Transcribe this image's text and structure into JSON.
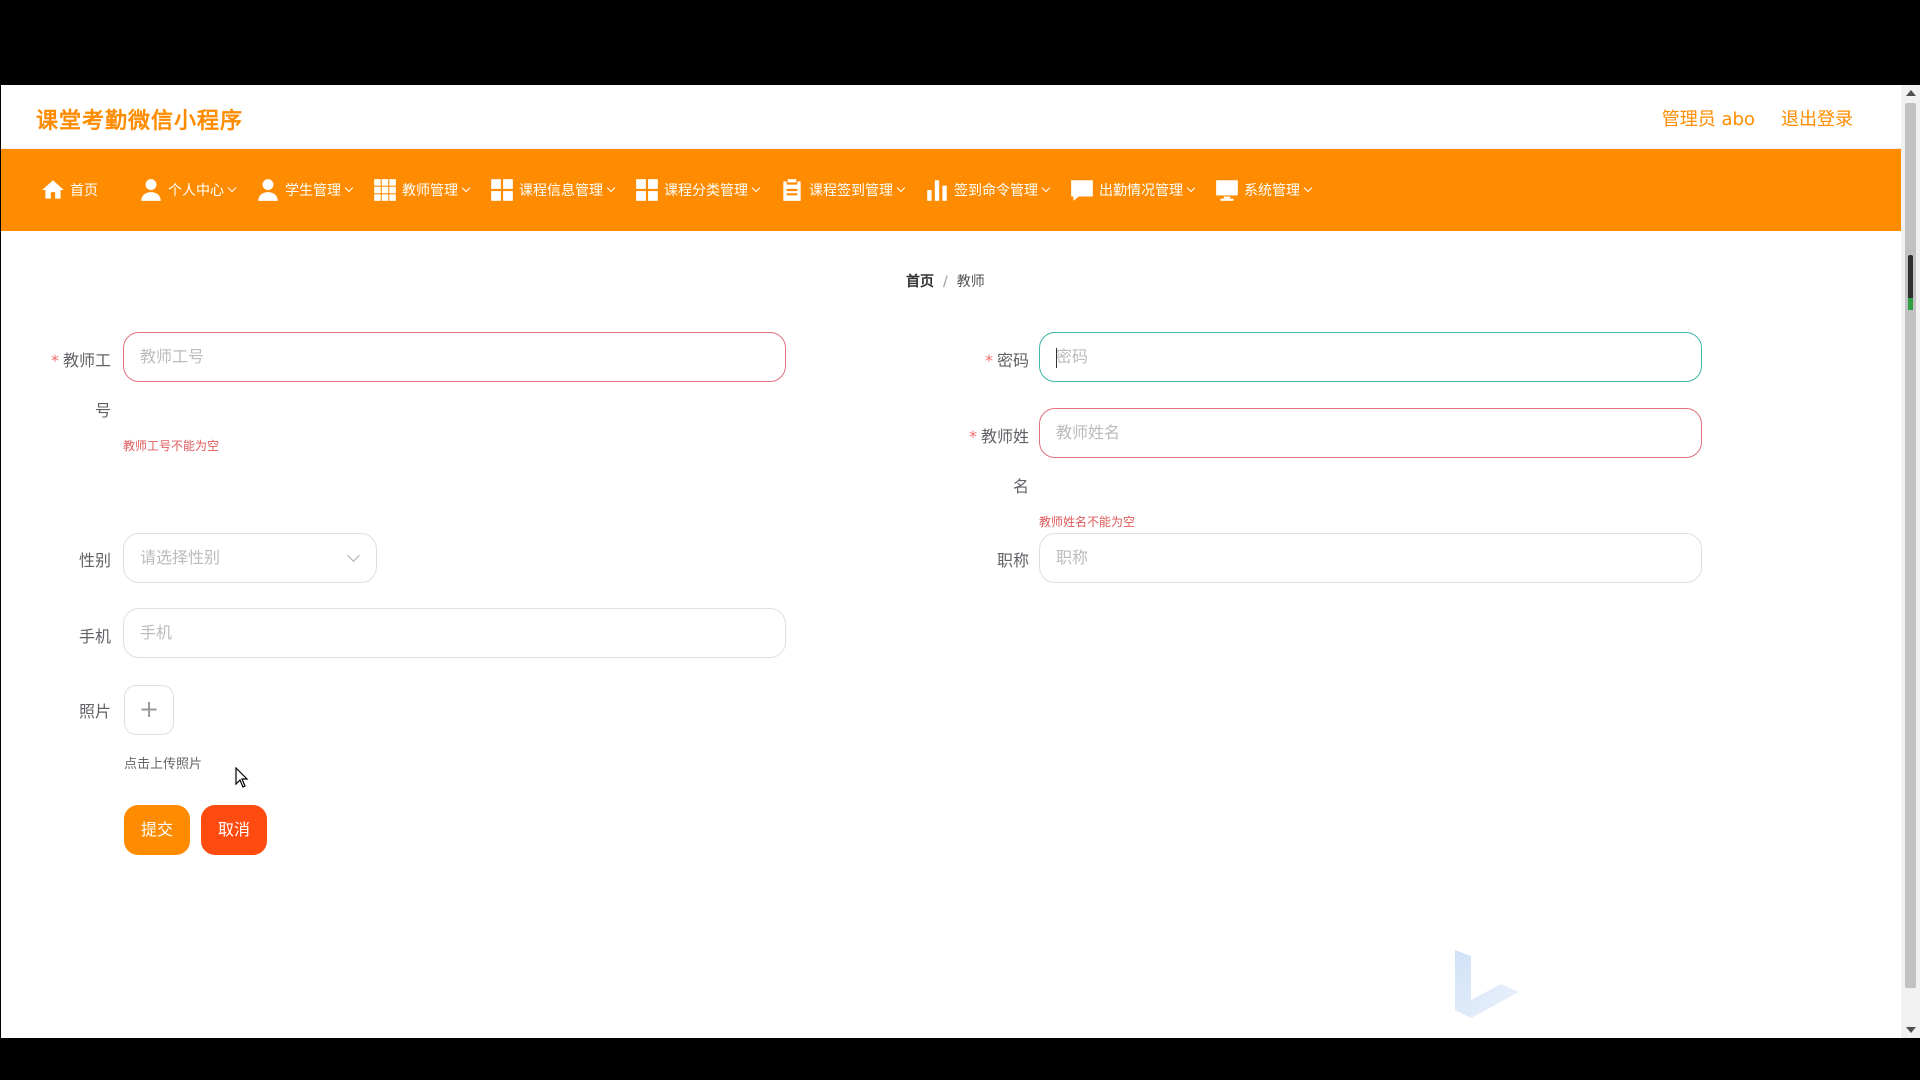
{
  "header": {
    "app_title": "课堂考勤微信小程序",
    "admin_label": "管理员 abo",
    "logout_label": "退出登录"
  },
  "nav": {
    "items": [
      {
        "label": "首页",
        "icon": "home-icon",
        "dropdown": false
      },
      {
        "label": "个人中心",
        "icon": "person-icon",
        "dropdown": true
      },
      {
        "label": "学生管理",
        "icon": "person-icon",
        "dropdown": true
      },
      {
        "label": "教师管理",
        "icon": "grid-icon",
        "dropdown": true
      },
      {
        "label": "课程信息管理",
        "icon": "tiles-icon",
        "dropdown": true
      },
      {
        "label": "课程分类管理",
        "icon": "tiles-icon",
        "dropdown": true
      },
      {
        "label": "课程签到管理",
        "icon": "clipboard-icon",
        "dropdown": true
      },
      {
        "label": "签到命令管理",
        "icon": "bar-chart-icon",
        "dropdown": true
      },
      {
        "label": "出勤情况管理",
        "icon": "comment-icon",
        "dropdown": true
      },
      {
        "label": "系统管理",
        "icon": "monitor-icon",
        "dropdown": true
      }
    ]
  },
  "breadcrumb": {
    "home": "首页",
    "separator": "/",
    "current": "教师"
  },
  "form": {
    "teacher_id": {
      "label_line1": "教师工",
      "label_line2": "号",
      "placeholder": "教师工号",
      "error": "教师工号不能为空",
      "required": "*"
    },
    "password": {
      "label": "密码",
      "placeholder": "密码",
      "required": "*"
    },
    "teacher_name": {
      "label_line1": "教师姓",
      "label_line2": "名",
      "placeholder": "教师姓名",
      "error": "教师姓名不能为空",
      "required": "*"
    },
    "gender": {
      "label": "性别",
      "placeholder": "请选择性别"
    },
    "title": {
      "label": "职称",
      "placeholder": "职称"
    },
    "phone": {
      "label": "手机",
      "placeholder": "手机"
    },
    "photo": {
      "label": "照片",
      "upload_symbol": "+",
      "hint": "点击上传照片"
    }
  },
  "buttons": {
    "submit": "提交",
    "cancel": "取消"
  },
  "colors": {
    "brand": "#ff8c00",
    "cancel": "#ff4a10",
    "error": "#e2707e",
    "focus": "#3fb5a7"
  }
}
